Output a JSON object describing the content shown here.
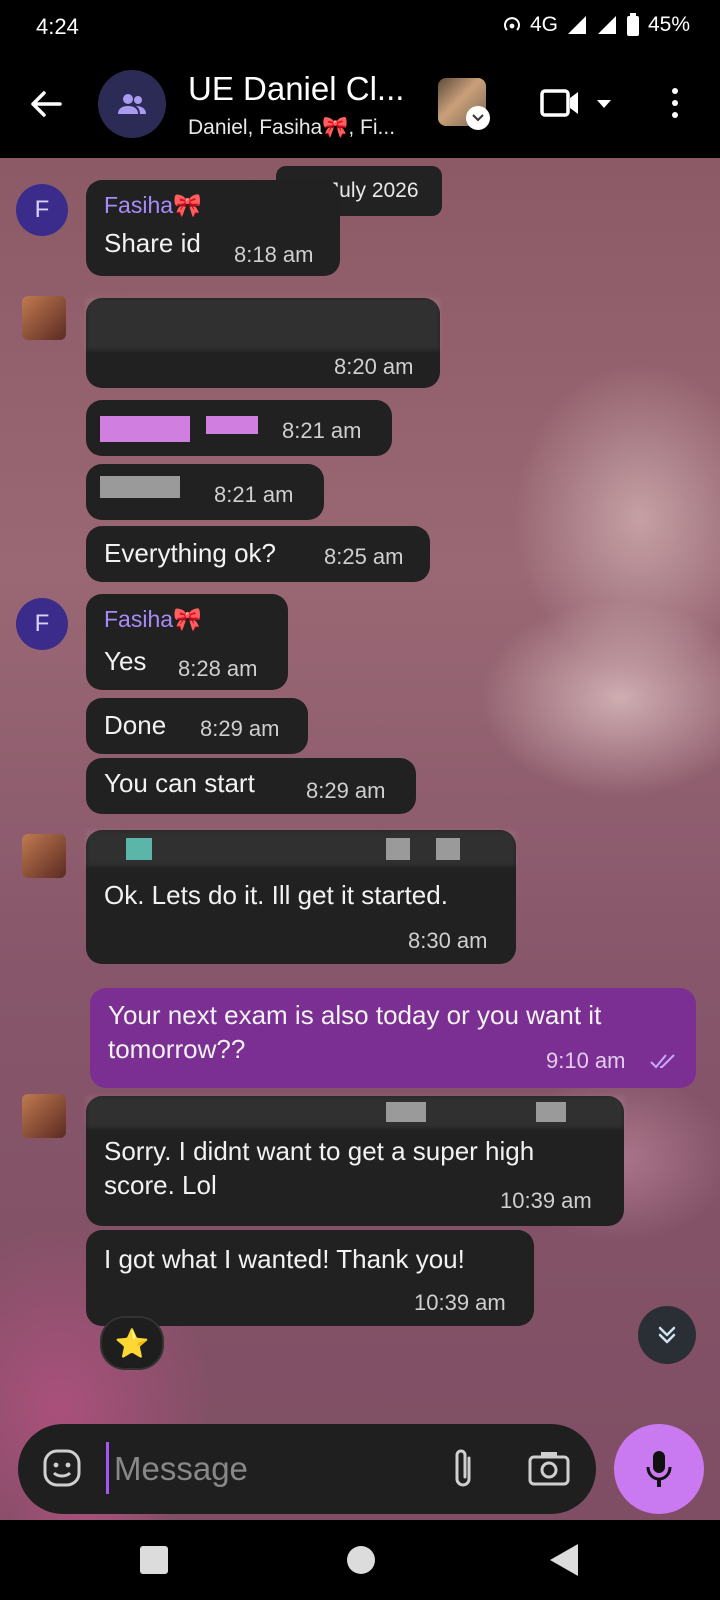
{
  "status_bar": {
    "time": "4:24",
    "network": "4G",
    "battery": "45%"
  },
  "header": {
    "title": "UE Daniel Cl...",
    "subtitle": "Daniel, Fasiha🎀, Fi..."
  },
  "chat": {
    "date": "22 July 2026",
    "messages": [
      {
        "sender": "Fasiha🎀",
        "avatar_letter": "F",
        "text": "Share id",
        "time": "8:18 am"
      },
      {
        "text": "",
        "time": "8:20 am"
      },
      {
        "text": "",
        "time": "8:21 am"
      },
      {
        "text": "",
        "time": "8:21 am"
      },
      {
        "text": "Everything ok?",
        "time": "8:25 am"
      },
      {
        "sender": "Fasiha🎀",
        "avatar_letter": "F",
        "text": "Yes",
        "time": "8:28 am"
      },
      {
        "text": "Done",
        "time": "8:29 am"
      },
      {
        "text": "You can start",
        "time": "8:29 am"
      },
      {
        "text": "Ok. Lets do it. Ill get it started.",
        "time": "8:30 am"
      },
      {
        "text_line1": "Your next exam is also today or you want it",
        "text_line2": "tomorrow??",
        "time": "9:10 am",
        "outgoing": true
      },
      {
        "text_line1": "Sorry. I didnt want to get a super high",
        "text_line2": "score. Lol",
        "time": "10:39 am"
      },
      {
        "text": "I got what I wanted! Thank you!",
        "time": "10:39 am"
      }
    ],
    "reaction": "⭐"
  },
  "composer": {
    "placeholder": "Message"
  },
  "colors": {
    "accent": "#c97af0",
    "outgoing_bubble": "#7b2f93",
    "incoming_bubble": "#212121",
    "sender_name": "#a78bfa"
  }
}
